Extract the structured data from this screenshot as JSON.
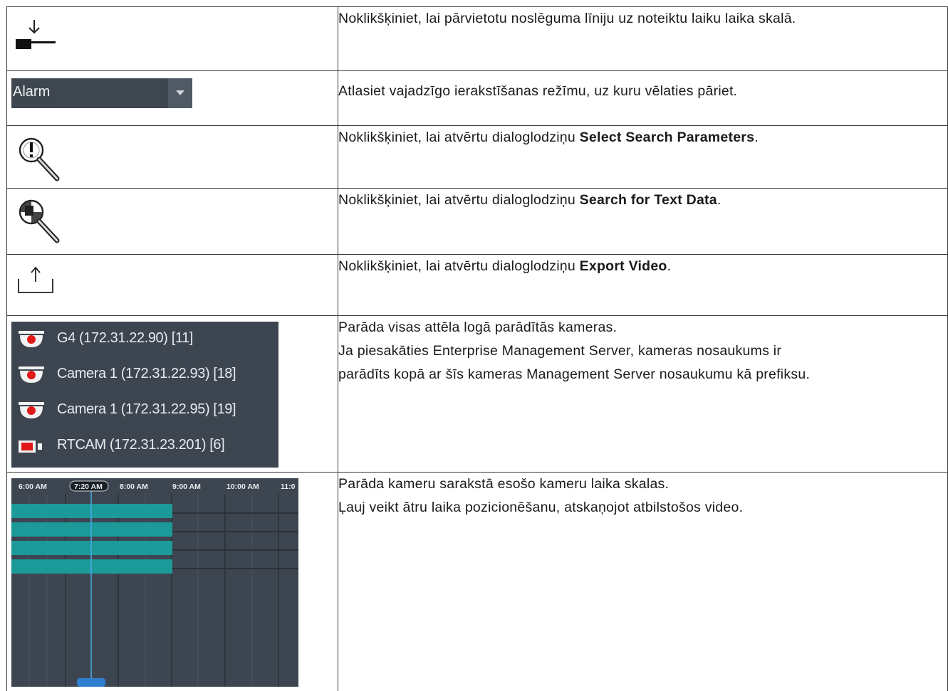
{
  "rows": [
    {
      "icon": "move-end-line-icon",
      "text": "Noklikšķiniet, lai pārvietotu noslēguma līniju uz noteiktu laiku laika skalā."
    },
    {
      "icon": "dropdown",
      "text": "Atlasiet vajadzīgo ierakstīšanas režīmu, uz kuru vēlaties pāriet."
    },
    {
      "icon": "search-parameters-icon",
      "text_before": "Noklikšķiniet, lai atvērtu dialoglodziņu ",
      "bold": "Select Search Parameters",
      "text_after": "."
    },
    {
      "icon": "search-text-data-icon",
      "text_before": "Noklikšķiniet, lai atvērtu dialoglodziņu ",
      "bold": "Search for Text Data",
      "text_after": "."
    },
    {
      "icon": "export-icon",
      "text_before": "Noklikšķiniet, lai atvērtu dialoglodziņu ",
      "bold": "Export Video",
      "text_after": "."
    },
    {
      "icon": "camera-list",
      "lines": [
        "Parāda visas attēla logā parādītās kameras.",
        "Ja piesakāties Enterprise Management Server, kameras nosaukums ir",
        "parādīts kopā ar šīs kameras Management Server nosaukumu kā prefiksu."
      ]
    },
    {
      "icon": "timeline",
      "lines": [
        "Parāda kameru sarakstā esošo kameru laika skalas.",
        "Ļauj veikt ātru laika pozicionēšanu, atskaņojot atbilstošos video."
      ]
    }
  ],
  "dropdown": {
    "value": "Alarm"
  },
  "cameras": [
    {
      "label": "G4 (172.31.22.90) [11]",
      "icon": "dome-camera-icon"
    },
    {
      "label": "Camera 1 (172.31.22.93) [18]",
      "icon": "dome-camera-icon"
    },
    {
      "label": "Camera 1 (172.31.22.95) [19]",
      "icon": "dome-camera-icon"
    },
    {
      "label": "RTCAM (172.31.23.201) [6]",
      "icon": "box-camera-icon"
    }
  ],
  "timeline": {
    "ticks": [
      "6:00 AM",
      "7:20 AM",
      "8:00 AM",
      "9:00 AM",
      "10:00 AM",
      "11:0"
    ],
    "current": "7:20 AM",
    "colors": {
      "bg": "#3c4550",
      "track": "#1c9a99",
      "cursor": "#4aa8e8"
    }
  }
}
